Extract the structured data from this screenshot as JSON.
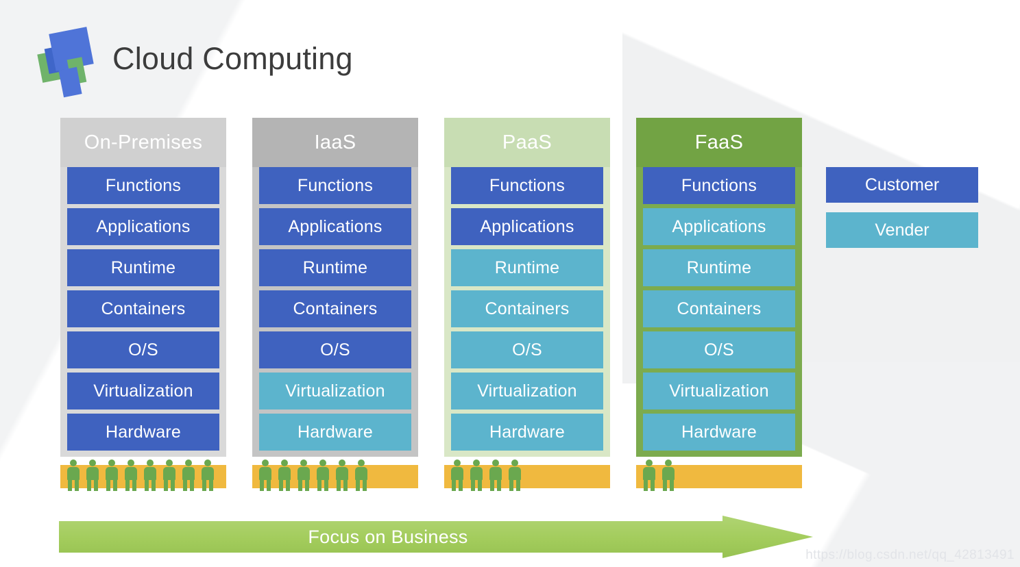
{
  "header": {
    "title": "Cloud Computing",
    "logo_name": "cloud-computing-logo"
  },
  "colors": {
    "customer": "#3f62bf",
    "vendor": "#5cb4cd",
    "onprem_header": "#d0d0d0",
    "iaas_header": "#b4b4b4",
    "paas_header": "#c8ddb3",
    "faas_header": "#72a344",
    "people_bar": "#f0b93f",
    "person": "#6aa84f",
    "arrow": "#a6cd5f",
    "title_text": "#3c3c3c"
  },
  "layer_names": [
    "Functions",
    "Applications",
    "Runtime",
    "Containers",
    "O/S",
    "Virtualization",
    "Hardware"
  ],
  "columns": [
    {
      "id": "onprem",
      "title": "On-Premises",
      "people": 8,
      "layers": [
        {
          "label": "Functions",
          "owner": "customer"
        },
        {
          "label": "Applications",
          "owner": "customer"
        },
        {
          "label": "Runtime",
          "owner": "customer"
        },
        {
          "label": "Containers",
          "owner": "customer"
        },
        {
          "label": "O/S",
          "owner": "customer"
        },
        {
          "label": "Virtualization",
          "owner": "customer"
        },
        {
          "label": "Hardware",
          "owner": "customer"
        }
      ]
    },
    {
      "id": "iaas",
      "title": "IaaS",
      "people": 6,
      "layers": [
        {
          "label": "Functions",
          "owner": "customer"
        },
        {
          "label": "Applications",
          "owner": "customer"
        },
        {
          "label": "Runtime",
          "owner": "customer"
        },
        {
          "label": "Containers",
          "owner": "customer"
        },
        {
          "label": "O/S",
          "owner": "customer"
        },
        {
          "label": "Virtualization",
          "owner": "vendor"
        },
        {
          "label": "Hardware",
          "owner": "vendor"
        }
      ]
    },
    {
      "id": "paas",
      "title": "PaaS",
      "people": 4,
      "layers": [
        {
          "label": "Functions",
          "owner": "customer"
        },
        {
          "label": "Applications",
          "owner": "customer"
        },
        {
          "label": "Runtime",
          "owner": "vendor"
        },
        {
          "label": "Containers",
          "owner": "vendor"
        },
        {
          "label": "O/S",
          "owner": "vendor"
        },
        {
          "label": "Virtualization",
          "owner": "vendor"
        },
        {
          "label": "Hardware",
          "owner": "vendor"
        }
      ]
    },
    {
      "id": "faas",
      "title": "FaaS",
      "people": 2,
      "layers": [
        {
          "label": "Functions",
          "owner": "customer"
        },
        {
          "label": "Applications",
          "owner": "vendor"
        },
        {
          "label": "Runtime",
          "owner": "vendor"
        },
        {
          "label": "Containers",
          "owner": "vendor"
        },
        {
          "label": "O/S",
          "owner": "vendor"
        },
        {
          "label": "Virtualization",
          "owner": "vendor"
        },
        {
          "label": "Hardware",
          "owner": "vendor"
        }
      ]
    }
  ],
  "legend": {
    "customer_label": "Customer",
    "vendor_label": "Vender"
  },
  "arrow": {
    "label": "Focus on Business"
  },
  "watermark": {
    "text": "https://blog.csdn.net/qq_42813491"
  }
}
